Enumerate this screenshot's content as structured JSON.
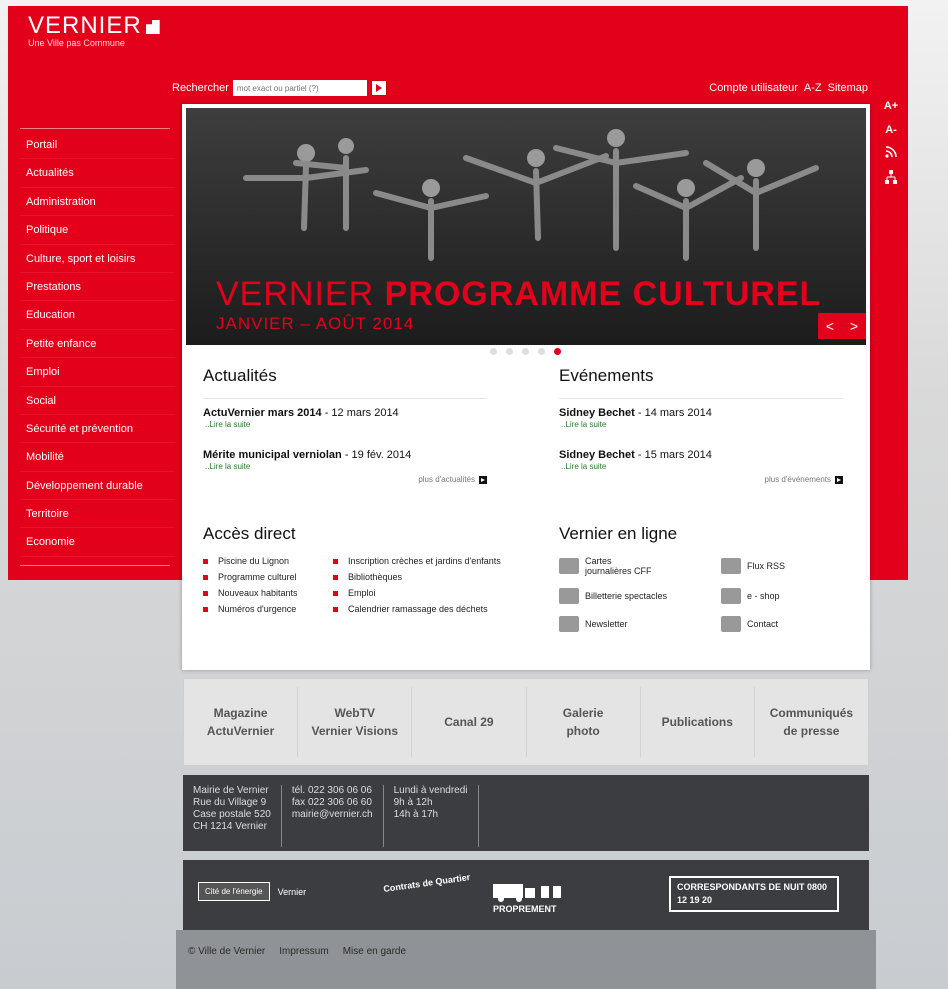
{
  "header": {
    "logo": "VERNIER",
    "tagline": "Une Ville pas Commune",
    "search_label": "Rechercher",
    "search_placeholder": "mot exact ou partiel (?)",
    "top_links": [
      "Compte utilisateur",
      "A-Z",
      "Sitemap"
    ]
  },
  "tools": [
    "A+",
    "A-",
    "rss-icon",
    "sitemap-icon"
  ],
  "sidebar": {
    "items": [
      "Portail",
      "Actualités",
      "Administration",
      "Politique",
      "Culture, sport et loisirs",
      "Prestations",
      "Education",
      "Petite enfance",
      "Emploi",
      "Social",
      "Sécurité et prévention",
      "Mobilité",
      "Développement durable",
      "Territoire",
      "Economie"
    ]
  },
  "hero": {
    "title_light": "VERNIER",
    "title_bold": "PROGRAMME CULTUREL",
    "subtitle": "JANVIER – AOÛT 2014",
    "prev": "<",
    "next": ">"
  },
  "actualites": {
    "title": "Actualités",
    "items": [
      {
        "title": "ActuVernier mars 2014",
        "date": " - 12 mars 2014",
        "more": "..Lire la suite"
      },
      {
        "title": "Mérite municipal verniolan",
        "date": " - 19 fév. 2014",
        "more": "..Lire la suite"
      }
    ],
    "more_link": "plus d'actualités"
  },
  "evenements": {
    "title": "Evénements",
    "items": [
      {
        "title": "Sidney Bechet",
        "date": " - 14 mars 2014",
        "more": "..Lire la suite"
      },
      {
        "title": "Sidney Bechet",
        "date": " - 15 mars 2014",
        "more": "..Lire la suite"
      }
    ],
    "more_link": "plus d'événements"
  },
  "acces_direct": {
    "title": "Accès direct",
    "left": [
      "Piscine du Lignon",
      "Programme culturel",
      "Nouveaux habitants",
      "Numéros d'urgence"
    ],
    "right": [
      "Inscription crèches et jardins d'enfants",
      "Bibliothèques",
      "Emploi",
      "Calendrier ramassage des déchets"
    ]
  },
  "en_ligne": {
    "title": "Vernier en ligne",
    "items": [
      {
        "label": "Cartes journalières CFF",
        "icon": "ticket-icon"
      },
      {
        "label": "Flux RSS",
        "icon": "rss-icon"
      },
      {
        "label": "Billetterie spectacles",
        "icon": "ticket-icon"
      },
      {
        "label": "e - shop",
        "icon": "shop-icon"
      },
      {
        "label": "Newsletter",
        "icon": "envelope-icon"
      },
      {
        "label": "Contact",
        "icon": "contact-icon"
      }
    ]
  },
  "navbar": [
    "Magazine\nActuVernier",
    "WebTV\nVernier Visions",
    "Canal 29",
    "Galerie\nphoto",
    "Publications",
    "Communiqués\nde presse"
  ],
  "footer_info": {
    "address": [
      "Mairie de Vernier",
      "Rue du Village 9",
      "Case postale 520",
      "CH 1214 Vernier"
    ],
    "contact": [
      "tél. 022 306 06 06",
      "fax 022 306 06 60",
      "mairie@vernier.ch"
    ],
    "hours": [
      "Lundi à vendredi",
      "9h à 12h",
      "14h à 17h"
    ]
  },
  "logos": {
    "cite": "Cité de l'énergie",
    "cite_sub": "Vernier",
    "contrats": "Contrats de Quartier",
    "proprement": "PROPREMENT",
    "correspondants": "CORRESPONDANTS DE NUIT 0800 12 19 20"
  },
  "bottom": [
    "© Ville de Vernier",
    "Impressum",
    "Mise en garde"
  ],
  "colors": {
    "brand_red": "#e3001b",
    "footer_dark": "#3b3d41",
    "nav_grey": "#e4e4e4"
  }
}
